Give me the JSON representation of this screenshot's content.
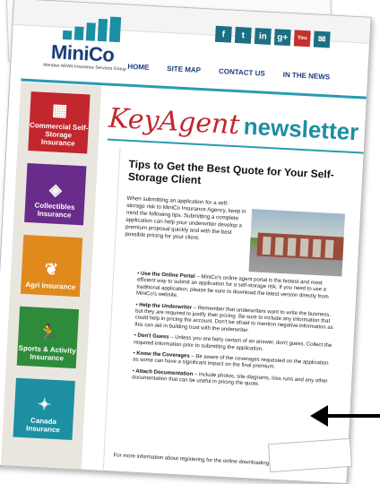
{
  "logo": {
    "name": "MiniCo",
    "tagline": "Member ARAN Insurance Services Group"
  },
  "social": [
    {
      "icon": "facebook-icon",
      "glyph": "f"
    },
    {
      "icon": "twitter-icon",
      "glyph": "t"
    },
    {
      "icon": "linkedin-icon",
      "glyph": "in"
    },
    {
      "icon": "googleplus-icon",
      "glyph": "g+"
    },
    {
      "icon": "youtube-icon",
      "glyph": "You"
    },
    {
      "icon": "email-icon",
      "glyph": "✉"
    }
  ],
  "nav": {
    "home": "HOME",
    "sitemap": "SITE MAP",
    "contact": "CONTACT US",
    "news": "IN THE NEWS"
  },
  "sidebar": {
    "items": [
      {
        "label": "Commercial Self-Storage Insurance",
        "color": "#c1272d",
        "icon": "storage-icon"
      },
      {
        "label": "Collectibles Insurance",
        "color": "#6a2c8a",
        "icon": "gem-icon"
      },
      {
        "label": "Agri Insurance",
        "color": "#e08a1e",
        "icon": "wheat-icon"
      },
      {
        "label": "Sports & Activity Insurance",
        "color": "#2e8b3a",
        "icon": "runner-icon"
      },
      {
        "label": "Canada Insurance",
        "color": "#1c8fa3",
        "icon": "maple-leaf-icon"
      }
    ]
  },
  "title": {
    "key": "KeyAgent",
    "news": "newsletter"
  },
  "article": {
    "heading": "Tips to Get the Best Quote for Your Self-Storage Client",
    "intro": "When submitting an application for a self-storage risk to MiniCo Insurance Agency, keep in mind the following tips. Submitting a complete application can help your underwriter develop a premium proposal quickly and with the best possible pricing for your client.",
    "bullets": [
      {
        "title": "Use the Online Portal",
        "text": " – MiniCo's online agent portal is the fastest and most efficient way to submit an application for a self-storage risk. If you need to use a traditional application, please be sure to download the latest version directly from MiniCo's website."
      },
      {
        "title": "Help the Underwriter",
        "text": " – Remember that underwriters want to write the business, but they are required to justify their pricing. Be sure to include any information that could help in pricing the account. Don't be afraid to mention negative information as this can aid in building trust with the underwriter."
      },
      {
        "title": "Don't Guess",
        "text": " – Unless you are fairly certain of an answer, don't guess. Collect the required information prior to submitting the application."
      },
      {
        "title": "Know the Coverages",
        "text": " – Be aware of the coverages requested on the application as some can have a significant impact on the final premium."
      },
      {
        "title": "Attach Documentation",
        "text": " – Include photos, site diagrams, loss runs and any other documentation that can be useful in pricing the quote."
      }
    ],
    "footer": "For more information about registering for the online downloading an application"
  }
}
